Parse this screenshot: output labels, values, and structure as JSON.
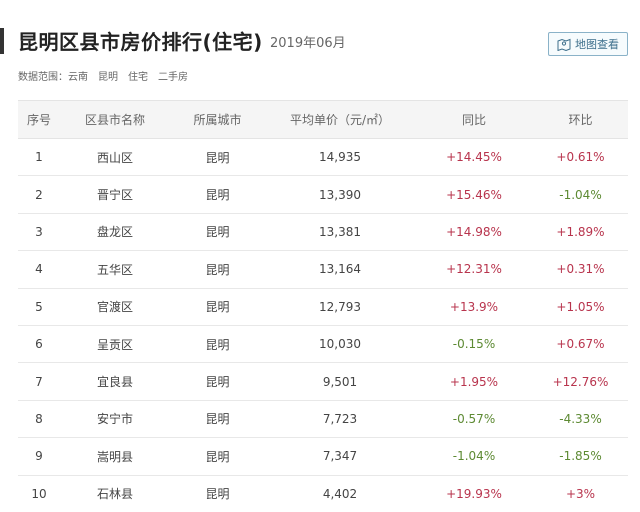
{
  "header": {
    "title": "昆明区县市房价排行(住宅)",
    "period": "2019年06月",
    "map_button": "地图查看",
    "scope_label": "数据范围：",
    "scope_tags": [
      "云南",
      "昆明",
      "住宅",
      "二手房"
    ]
  },
  "table": {
    "columns": [
      "序号",
      "区县市名称",
      "所属城市",
      "平均单价（元/㎡）",
      "同比",
      "环比"
    ],
    "rows": [
      {
        "idx": "1",
        "name": "西山区",
        "city": "昆明",
        "price": "14,935",
        "yoy": "+14.45%",
        "mom": "+0.61%"
      },
      {
        "idx": "2",
        "name": "晋宁区",
        "city": "昆明",
        "price": "13,390",
        "yoy": "+15.46%",
        "mom": "-1.04%"
      },
      {
        "idx": "3",
        "name": "盘龙区",
        "city": "昆明",
        "price": "13,381",
        "yoy": "+14.98%",
        "mom": "+1.89%"
      },
      {
        "idx": "4",
        "name": "五华区",
        "city": "昆明",
        "price": "13,164",
        "yoy": "+12.31%",
        "mom": "+0.31%"
      },
      {
        "idx": "5",
        "name": "官渡区",
        "city": "昆明",
        "price": "12,793",
        "yoy": "+13.9%",
        "mom": "+1.05%"
      },
      {
        "idx": "6",
        "name": "呈贡区",
        "city": "昆明",
        "price": "10,030",
        "yoy": "-0.15%",
        "mom": "+0.67%"
      },
      {
        "idx": "7",
        "name": "宜良县",
        "city": "昆明",
        "price": "9,501",
        "yoy": "+1.95%",
        "mom": "+12.76%"
      },
      {
        "idx": "8",
        "name": "安宁市",
        "city": "昆明",
        "price": "7,723",
        "yoy": "-0.57%",
        "mom": "-4.33%"
      },
      {
        "idx": "9",
        "name": "嵩明县",
        "city": "昆明",
        "price": "7,347",
        "yoy": "-1.04%",
        "mom": "-1.85%"
      },
      {
        "idx": "10",
        "name": "石林县",
        "city": "昆明",
        "price": "4,402",
        "yoy": "+19.93%",
        "mom": "+3%"
      }
    ]
  },
  "colors": {
    "increase": "#b8344d",
    "decrease": "#5d8a33",
    "button_border": "#8ab2c8",
    "button_text": "#3d6f8c"
  },
  "icons": {
    "map_button": "map-icon"
  }
}
